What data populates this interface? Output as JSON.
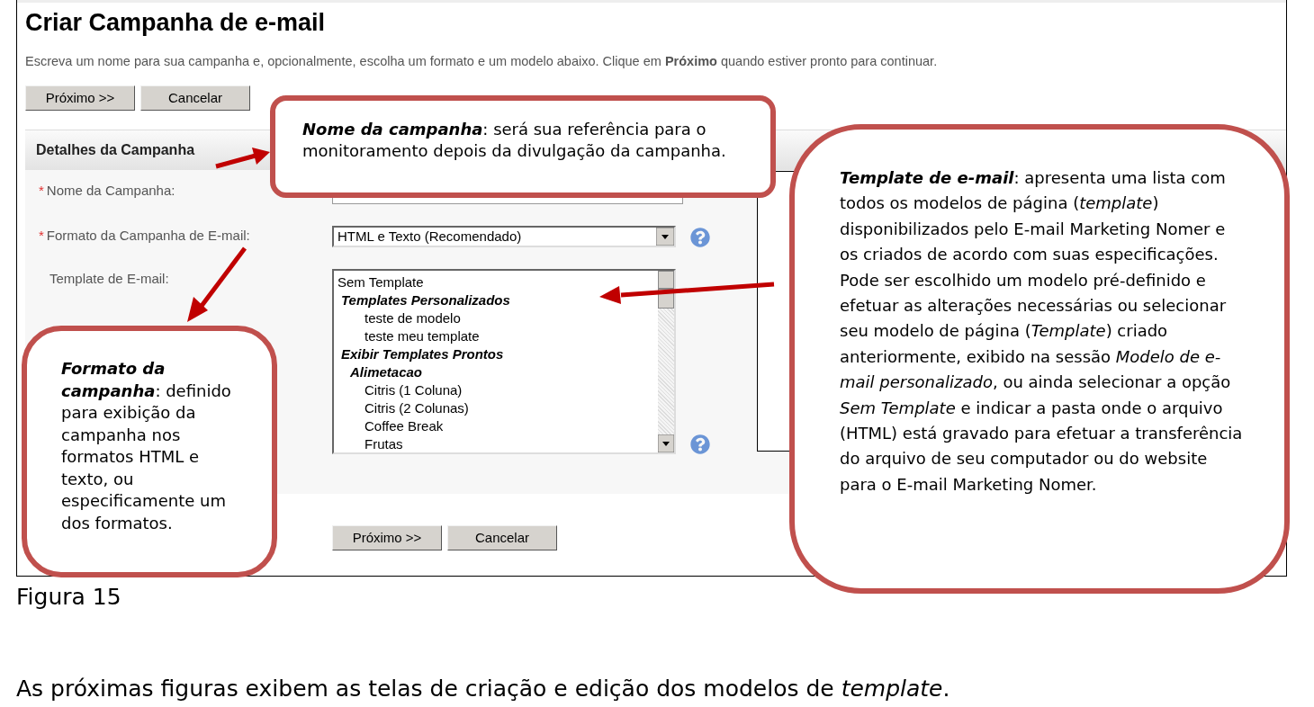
{
  "screen": {
    "title": "Criar Campanha de e-mail",
    "intro": "Escreva um nome para sua campanha e, opcionalmente, escolha um formato e um modelo abaixo. Clique em **Próximo** quando estiver pronto para continuar.",
    "top_buttons": [
      "Próximo >>",
      "Cancelar"
    ],
    "section_title": "Detalhes da Campanha",
    "fields": [
      {
        "kind": "text",
        "marker": "*",
        "label": "Nome da Campanha:",
        "help": false
      },
      {
        "kind": "select",
        "marker": "*",
        "label": "Formato da Campanha de E-mail:",
        "value": "HTML e Texto (Recomendado)",
        "help": true
      },
      {
        "kind": "list",
        "label": "Template de E-mail:",
        "help": true,
        "items": [
          {
            "kind": "option",
            "text": "Sem Template"
          },
          {
            "kind": "group",
            "text": "Templates Personalizados",
            "children": [
              {
                "kind": "option",
                "text": "teste de modelo"
              },
              {
                "kind": "option",
                "text": "teste meu template"
              }
            ]
          },
          {
            "kind": "group",
            "text": "Exibir Templates Prontos",
            "children": [
              {
                "kind": "group",
                "text": "Alimetacao",
                "children": [
                  {
                    "kind": "option",
                    "text": "Citris (1 Coluna)"
                  },
                  {
                    "kind": "option",
                    "text": "Citris (2 Colunas)"
                  },
                  {
                    "kind": "option",
                    "text": "Coffee Break"
                  },
                  {
                    "kind": "option",
                    "text": "Frutas"
                  }
                ]
              }
            ]
          }
        ]
      }
    ],
    "bottom_buttons": [
      "Próximo >>",
      "Cancelar"
    ]
  },
  "callouts": [
    {
      "text": "**Nome da campanha**: será sua referência para o monitoramento depois da divulgação da campanha."
    },
    {
      "text": "**Formato da campanha**: definido para exibição da campanha nos formatos HTML e texto, ou especificamente um dos formatos."
    },
    {
      "text": "**Template de e-mail**: apresenta uma lista com todos os modelos de página (*template*) disponibilizados pelo E-mail Marketing Nomer e os criados de acordo com suas especificações. Pode ser escolhido um modelo pré-definido e efetuar as alterações necessárias ou selecionar seu modelo de página (*Template*) criado anteriormente, exibido na sessão *Modelo de e-mail personalizado*, ou ainda selecionar a opção *Sem Template* e indicar a pasta onde o arquivo (HTML) está gravado para efetuar a transferência do arquivo de seu computador ou do website para o E-mail Marketing Nomer."
    }
  ],
  "caption": "Figura 15",
  "body_text": "As próximas figuras exibem as telas de criação e edição dos modelos de *template*."
}
